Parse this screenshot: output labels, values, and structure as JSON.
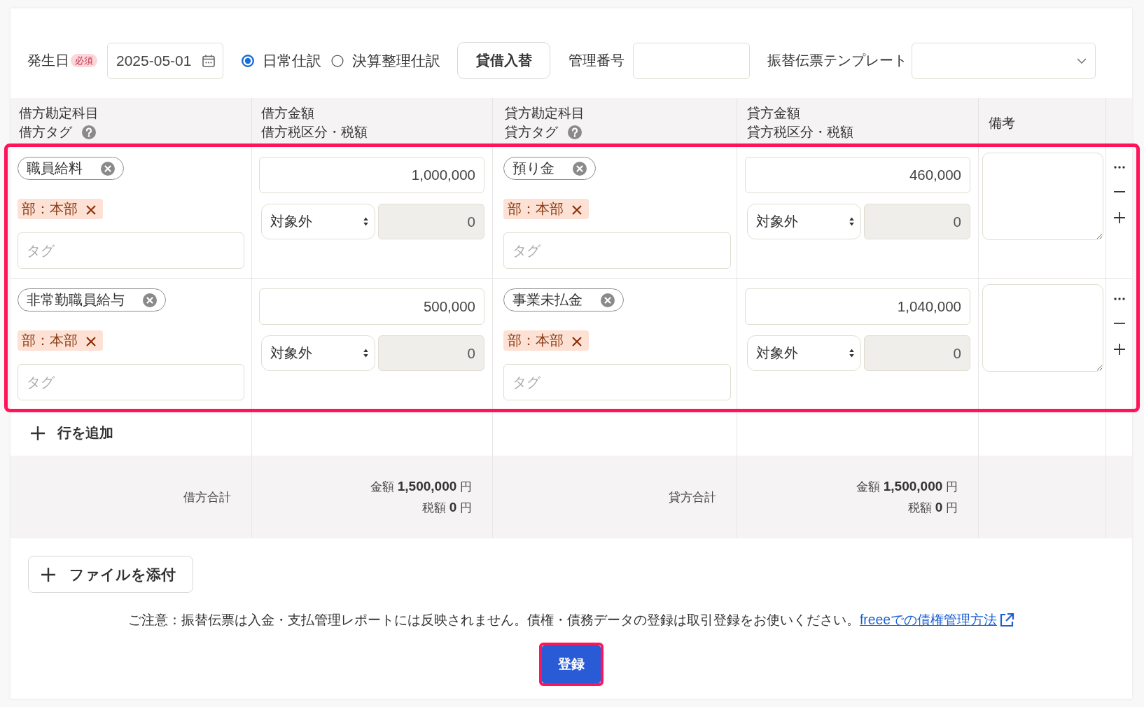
{
  "header": {
    "date": {
      "label": "発生日",
      "badge": "必須",
      "value": "2025-05-01"
    },
    "entry_types": [
      {
        "label": "日常仕訳",
        "selected": true
      },
      {
        "label": "決算整理仕訳",
        "selected": false
      }
    ],
    "swap_button": "貸借入替",
    "management_number": {
      "label": "管理番号"
    },
    "template": {
      "label": "振替伝票テンプレート"
    }
  },
  "table": {
    "columns": [
      {
        "lines": [
          "借方勘定科目",
          "借方タグ"
        ],
        "help": true
      },
      {
        "lines": [
          "借方金額",
          "借方税区分・税額"
        ],
        "help": false
      },
      {
        "lines": [
          "貸方勘定科目",
          "貸方タグ"
        ],
        "help": true
      },
      {
        "lines": [
          "貸方金額",
          "貸方税区分・税額"
        ],
        "help": false
      },
      {
        "lines": [
          "備考"
        ],
        "help": false
      }
    ],
    "rows_highlighted": true,
    "rows": [
      {
        "debit": {
          "account": "職員給料",
          "tags": [
            "部：本部"
          ],
          "tag_placeholder": "タグ",
          "amount": "1,000,000",
          "tax_category": "対象外",
          "tax_amount": "0",
          "tax_amount_disabled": true
        },
        "credit": {
          "account": "預り金",
          "tags": [
            "部：本部"
          ],
          "tag_placeholder": "タグ",
          "amount": "460,000",
          "tax_category": "対象外",
          "tax_amount": "0",
          "tax_amount_disabled": true
        }
      },
      {
        "debit": {
          "account": "非常勤職員給与",
          "tags": [
            "部：本部"
          ],
          "tag_placeholder": "タグ",
          "amount": "500,000",
          "tax_category": "対象外",
          "tax_amount": "0",
          "tax_amount_disabled": true
        },
        "credit": {
          "account": "事業未払金",
          "tags": [
            "部：本部"
          ],
          "tag_placeholder": "タグ",
          "amount": "1,040,000",
          "tax_category": "対象外",
          "tax_amount": "0",
          "tax_amount_disabled": true
        }
      }
    ],
    "add_row": "行を追加",
    "totals": [
      {
        "label": "借方合計",
        "amount": "金額 **1,500,000** 円",
        "tax": "税額 **0** 円"
      },
      {
        "label": "貸方合計",
        "amount": "金額 **1,500,000** 円",
        "tax": "税額 **0** 円"
      }
    ]
  },
  "attach_button": "ファイルを添付",
  "notice": {
    "text": "ご注意：振替伝票は入金・支払管理レポートには反映されません。債権・債務データの登録は取引登録をお使いください。",
    "link": "freeeでの債権管理方法"
  },
  "submit": {
    "label": "登録",
    "highlighted": true
  }
}
